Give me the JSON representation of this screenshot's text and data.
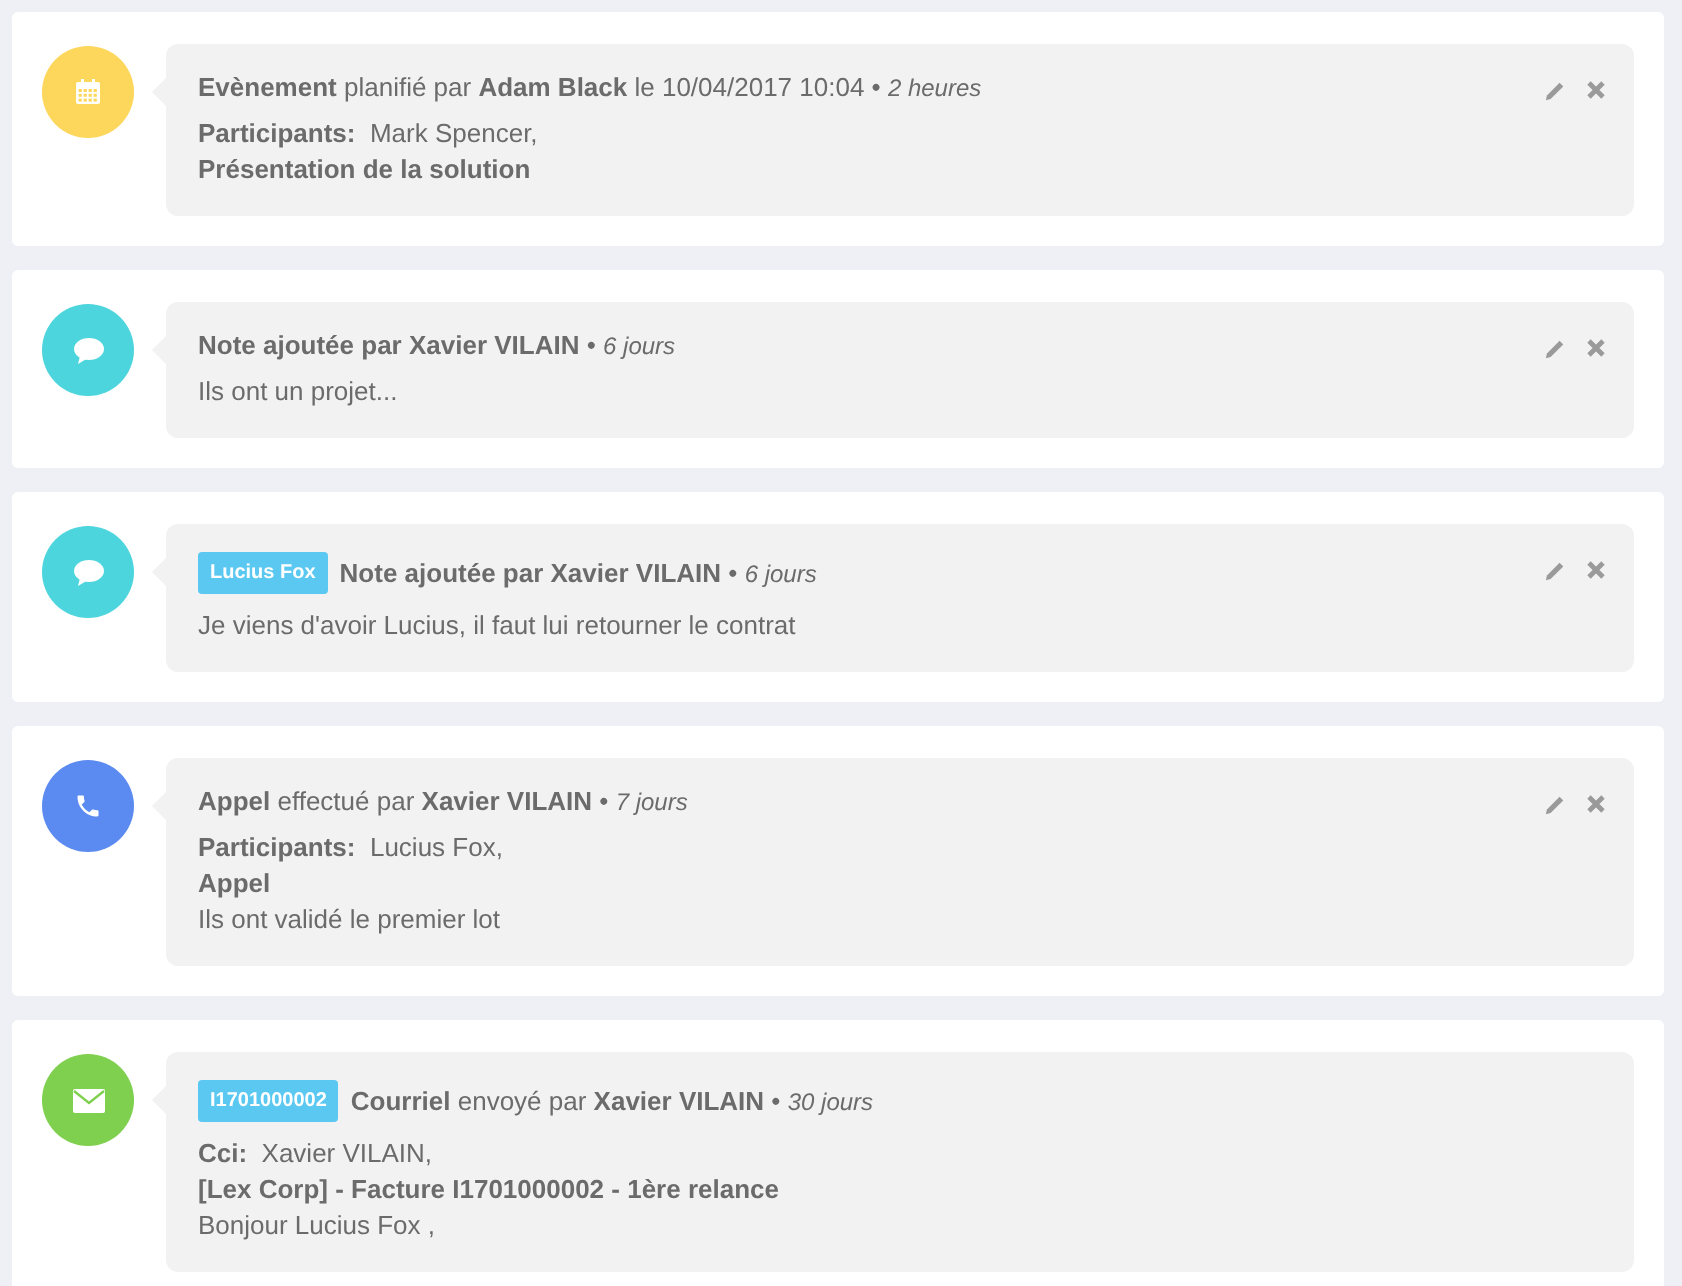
{
  "entries": [
    {
      "kind": "event",
      "color": "#fdd75c",
      "header": "**Evènement** planifié par **Adam Black** le 10/04/2017 10:04 • *2 heures*",
      "actions": true,
      "lines": [
        {
          "kind": "plain",
          "text": "**Participants:**  Mark Spencer,"
        },
        {
          "kind": "bold",
          "text": "Présentation de la solution"
        }
      ]
    },
    {
      "kind": "note",
      "color": "#4dd5dd",
      "header": "**Note ajoutée par Xavier VILAIN** • *6 jours*",
      "actions": true,
      "lines": [
        {
          "kind": "plain",
          "text": "Ils ont un projet..."
        }
      ]
    },
    {
      "kind": "note",
      "color": "#4dd5dd",
      "tag": "Lucius Fox",
      "header": "**Note ajoutée par Xavier VILAIN** • *6 jours*",
      "actions": true,
      "lines": [
        {
          "kind": "plain",
          "text": "Je viens d'avoir Lucius, il faut lui retourner le contrat"
        }
      ]
    },
    {
      "kind": "call",
      "color": "#5b8af0",
      "header": "**Appel** effectué par **Xavier VILAIN** • *7 jours*",
      "actions": true,
      "lines": [
        {
          "kind": "plain",
          "text": "**Participants:**  Lucius Fox,"
        },
        {
          "kind": "bold",
          "text": "Appel"
        },
        {
          "kind": "plain",
          "text": "Ils ont validé le premier lot"
        }
      ]
    },
    {
      "kind": "email",
      "color": "#7ed04e",
      "tag": "I1701000002",
      "header": "**Courriel** envoyé par **Xavier VILAIN** • *30 jours*",
      "actions": false,
      "lines": [
        {
          "kind": "plain",
          "text": "**Cci:**  Xavier VILAIN,"
        },
        {
          "kind": "bold",
          "text": "[Lex Corp] - Facture I1701000002 - 1ère relance"
        },
        {
          "kind": "plain",
          "text": "Bonjour Lucius Fox ,"
        }
      ]
    }
  ]
}
